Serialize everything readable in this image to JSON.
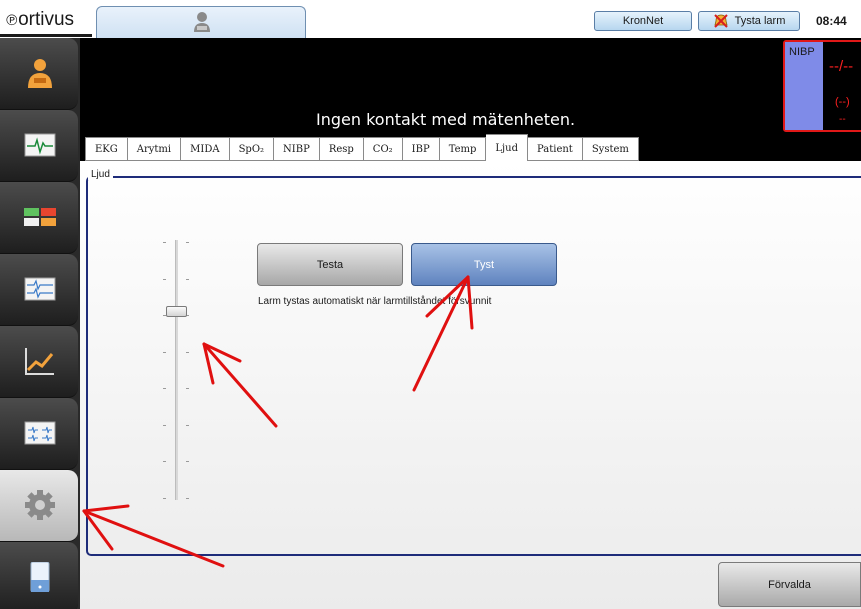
{
  "app": {
    "logo": "ortivus",
    "logo_mark": "℗"
  },
  "topbar": {
    "kronnet_label": "KronNet",
    "silence_alarm_label": "Tysta larm",
    "clock": "08:44"
  },
  "monitor": {
    "status_message": "Ingen kontakt med mätenheten.",
    "nibp": {
      "title": "NIBP",
      "value": "--/--",
      "mean": "(--)",
      "extra": "--"
    }
  },
  "tabs": [
    {
      "label": "EKG"
    },
    {
      "label": "Arytmi"
    },
    {
      "label": "MIDA"
    },
    {
      "label": "SpO₂"
    },
    {
      "label": "NIBP"
    },
    {
      "label": "Resp"
    },
    {
      "label": "CO₂"
    },
    {
      "label": "IBP"
    },
    {
      "label": "Temp"
    },
    {
      "label": "Ljud"
    },
    {
      "label": "Patient"
    },
    {
      "label": "System"
    }
  ],
  "active_tab": "Ljud",
  "sound_group": {
    "label": "Ljud",
    "test_button": "Testa",
    "mute_button": "Tyst",
    "info_text": "Larm tystas automatiskt när larmtillståndet försvunnit",
    "volume_level": 0.73
  },
  "footer": {
    "default_button": "Förvalda"
  },
  "sidebar": {
    "items": [
      {
        "icon": "patient-icon"
      },
      {
        "icon": "ecg-waveform-icon"
      },
      {
        "icon": "color-blocks-icon"
      },
      {
        "icon": "multi-waveform-icon"
      },
      {
        "icon": "trend-chart-icon"
      },
      {
        "icon": "waveform-grid-icon"
      },
      {
        "icon": "gear-icon"
      },
      {
        "icon": "device-icon"
      }
    ],
    "active_index": 6
  },
  "colors": {
    "alarm_red": "#e01818",
    "nibp_panel": "#7f8be8",
    "group_border": "#1e2c7a",
    "annotation_arrow": "#e01010"
  }
}
